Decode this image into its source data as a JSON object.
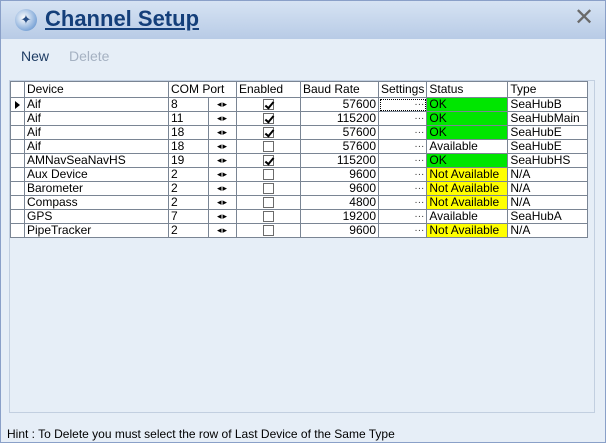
{
  "window": {
    "title": "Channel Setup",
    "close_glyph": "✕",
    "icon": "satellite-globe-icon"
  },
  "toolbar": {
    "new_label": "New",
    "delete_label": "Delete"
  },
  "grid": {
    "columns": [
      "Device",
      "COM Port",
      "Enabled",
      "Baud Rate",
      "Settings",
      "Status",
      "Type"
    ],
    "settings_glyph": "···",
    "stepper_glyph": "◂▸",
    "rows": [
      {
        "device": "Aif",
        "com_port": "8",
        "enabled": true,
        "baud_rate": "57600",
        "status": "OK",
        "status_color": "#00e600",
        "type": "SeaHubB"
      },
      {
        "device": "Aif",
        "com_port": "11",
        "enabled": true,
        "baud_rate": "115200",
        "status": "OK",
        "status_color": "#00e600",
        "type": "SeaHubMain"
      },
      {
        "device": "Aif",
        "com_port": "18",
        "enabled": true,
        "baud_rate": "57600",
        "status": "OK",
        "status_color": "#00e600",
        "type": "SeaHubE"
      },
      {
        "device": "Aif",
        "com_port": "18",
        "enabled": false,
        "baud_rate": "57600",
        "status": "Available",
        "status_color": "#ffffff",
        "type": "SeaHubE"
      },
      {
        "device": "AMNavSeaNavHS",
        "com_port": "19",
        "enabled": true,
        "baud_rate": "115200",
        "status": "OK",
        "status_color": "#00e600",
        "type": "SeaHubHS"
      },
      {
        "device": "Aux Device",
        "com_port": "2",
        "enabled": false,
        "baud_rate": "9600",
        "status": "Not Available",
        "status_color": "#ffff00",
        "type": "N/A"
      },
      {
        "device": "Barometer",
        "com_port": "2",
        "enabled": false,
        "baud_rate": "9600",
        "status": "Not Available",
        "status_color": "#ffff00",
        "type": "N/A"
      },
      {
        "device": "Compass",
        "com_port": "2",
        "enabled": false,
        "baud_rate": "4800",
        "status": "Not Available",
        "status_color": "#ffff00",
        "type": "N/A"
      },
      {
        "device": "GPS",
        "com_port": "7",
        "enabled": false,
        "baud_rate": "19200",
        "status": "Available",
        "status_color": "#ffffff",
        "type": "SeaHubA"
      },
      {
        "device": "PipeTracker",
        "com_port": "2",
        "enabled": false,
        "baud_rate": "9600",
        "status": "Not Available",
        "status_color": "#ffff00",
        "type": "N/A"
      }
    ]
  },
  "hint": "Hint : To Delete you must select the row of Last Device of the Same Type",
  "colors": {
    "title": "#143f7a",
    "window_bg": "#e6eef7",
    "ok": "#00e600",
    "not_available": "#ffff00"
  }
}
